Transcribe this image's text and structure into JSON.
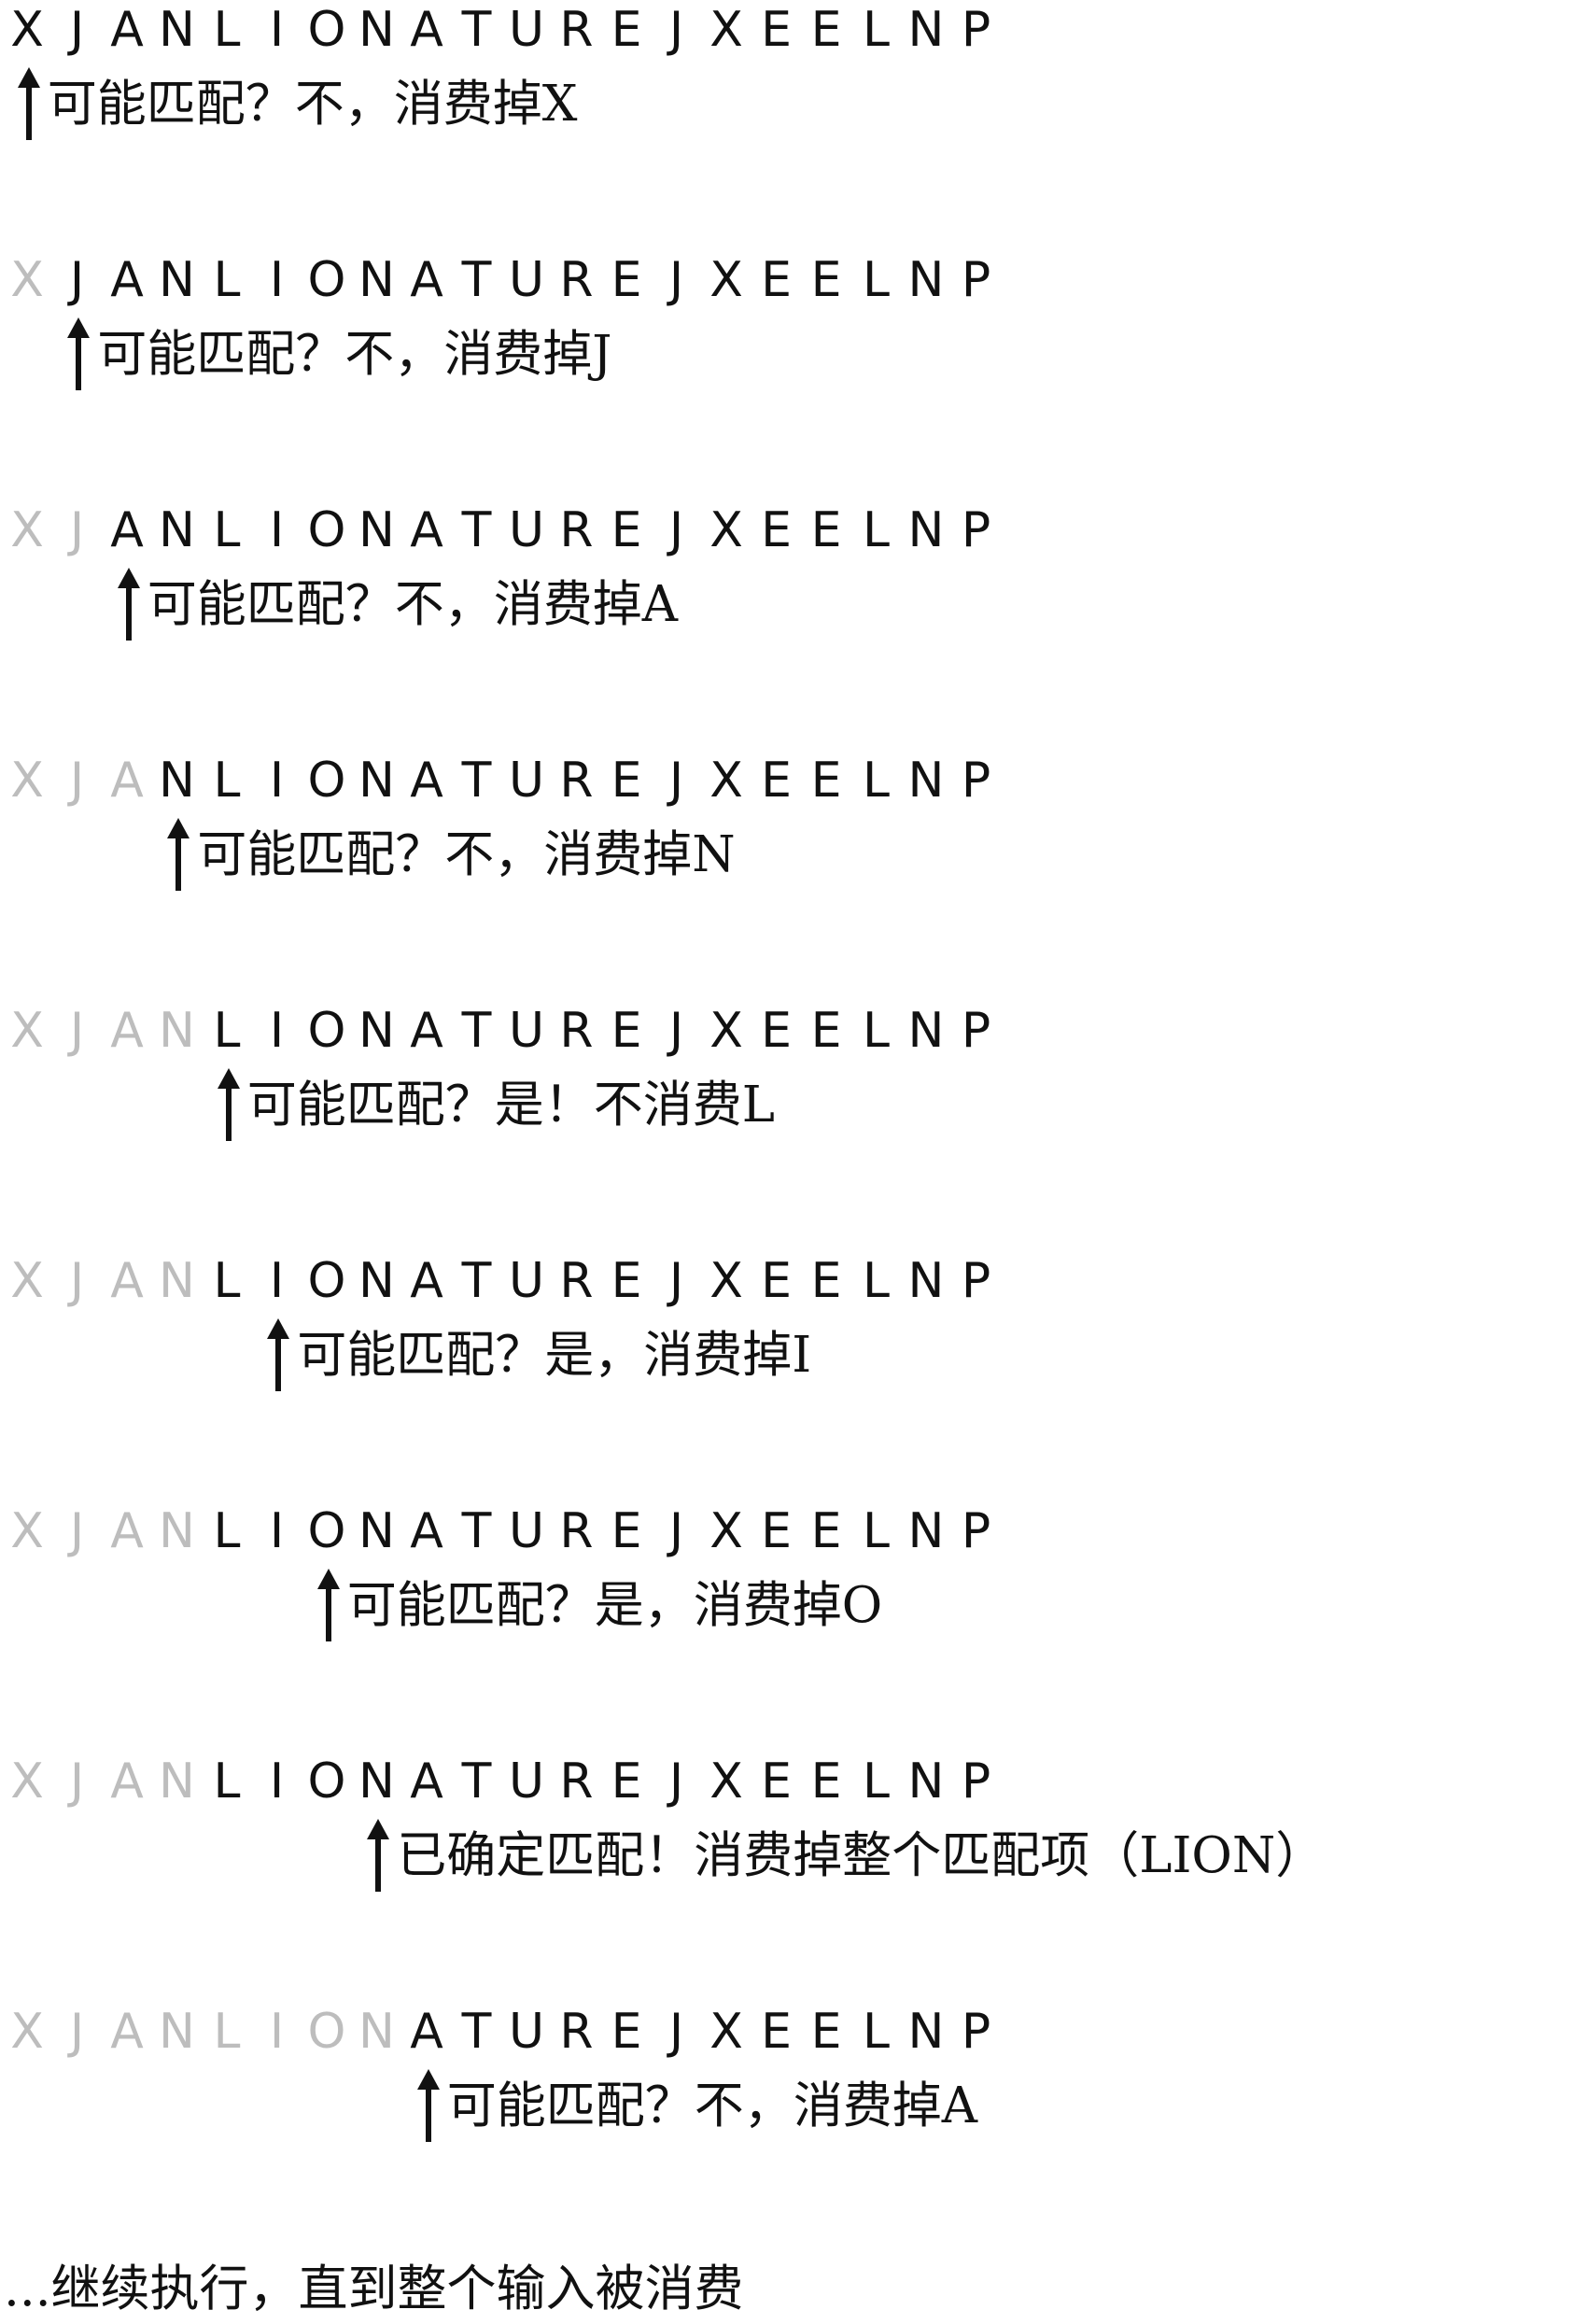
{
  "sequence": "XJANLIONATUREJXEELNP",
  "colors": {
    "active": "#111111",
    "consumed": "#bdbdbd"
  },
  "steps": [
    {
      "consumed": 0,
      "pointer": 0,
      "note": "可能匹配？不，消费掉X"
    },
    {
      "consumed": 1,
      "pointer": 1,
      "note": "可能匹配？不，消费掉J"
    },
    {
      "consumed": 2,
      "pointer": 2,
      "note": "可能匹配？不，消费掉A"
    },
    {
      "consumed": 3,
      "pointer": 3,
      "note": "可能匹配？不，消费掉N"
    },
    {
      "consumed": 4,
      "pointer": 4,
      "note": "可能匹配？是！不消费L"
    },
    {
      "consumed": 4,
      "pointer": 5,
      "note": "可能匹配？是，消费掉I"
    },
    {
      "consumed": 4,
      "pointer": 6,
      "note": "可能匹配？是，消费掉O"
    },
    {
      "consumed": 4,
      "pointer": 7,
      "note": "已确定匹配！消费掉整个匹配项（LION）"
    },
    {
      "consumed": 8,
      "pointer": 8,
      "note": "可能匹配？不，消费掉A"
    }
  ],
  "footer": "...继续执行，直到整个输入被消费"
}
